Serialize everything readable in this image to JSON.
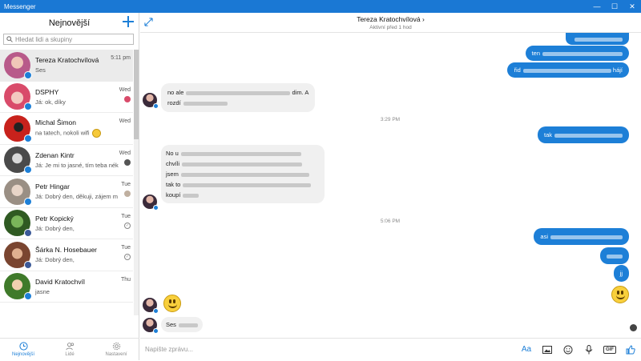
{
  "app": {
    "title": "Messenger"
  },
  "sidebar": {
    "title": "Nejnovější",
    "search_placeholder": "Hledat lidi a skupiny",
    "conversations": [
      {
        "name": "Tereza Kratochvílová",
        "preview": "Ses",
        "time": "5:11 pm",
        "color": "#b85a8a"
      },
      {
        "name": "DSPHY",
        "preview": "Já: ok, díky",
        "time": "Wed",
        "color": "#d94b6a"
      },
      {
        "name": "Michal Šimon",
        "preview": "na tatech, nokoli wifi",
        "time": "Wed",
        "color": "#c8221c"
      },
      {
        "name": "Zdenan Kintr",
        "preview": "Já: Je mi to jasné, tím teba nék",
        "time": "Wed",
        "color": "#5a5a5a"
      },
      {
        "name": "Petr Hingar",
        "preview": "Já: Dobrý den, děkuji, zájem m",
        "time": "Tue",
        "color": "#9a8f84"
      },
      {
        "name": "Petr Kopický",
        "preview": "Já: Dobrý den,",
        "time": "Tue",
        "color": "#4f8a3a"
      },
      {
        "name": "Šárka N. Hosebauer",
        "preview": "Já: Dobrý den,",
        "time": "Tue",
        "color": "#a06040"
      },
      {
        "name": "David Kratochvíl",
        "preview": "jasne",
        "time": "Thu",
        "color": "#3f7a2a"
      }
    ]
  },
  "nav": {
    "recent": "Nejnovější",
    "people": "Lidé",
    "settings": "Nastavení"
  },
  "chat": {
    "name": "Tereza Kratochvílová",
    "status": "Aktivní před 1 hod",
    "in_msg_1": "no ale",
    "in_msg_1_end": "dim. A",
    "in_msg_1_line2": "rozdí",
    "time_1": "3:29 PM",
    "out_msg_1": "tak",
    "in_msg_2": [
      "No u",
      "chvíli",
      "jsem",
      "tak to",
      "koupí"
    ],
    "time_2": "5:06 PM",
    "out_msg_2": "asi",
    "out_msg_3": "jj",
    "out_msg_top_1": "ten",
    "out_msg_top_2": "řid",
    "out_msg_top_2_end": "hájí",
    "in_msg_last": "Ses",
    "composer_placeholder": "Napište zprávu..."
  }
}
